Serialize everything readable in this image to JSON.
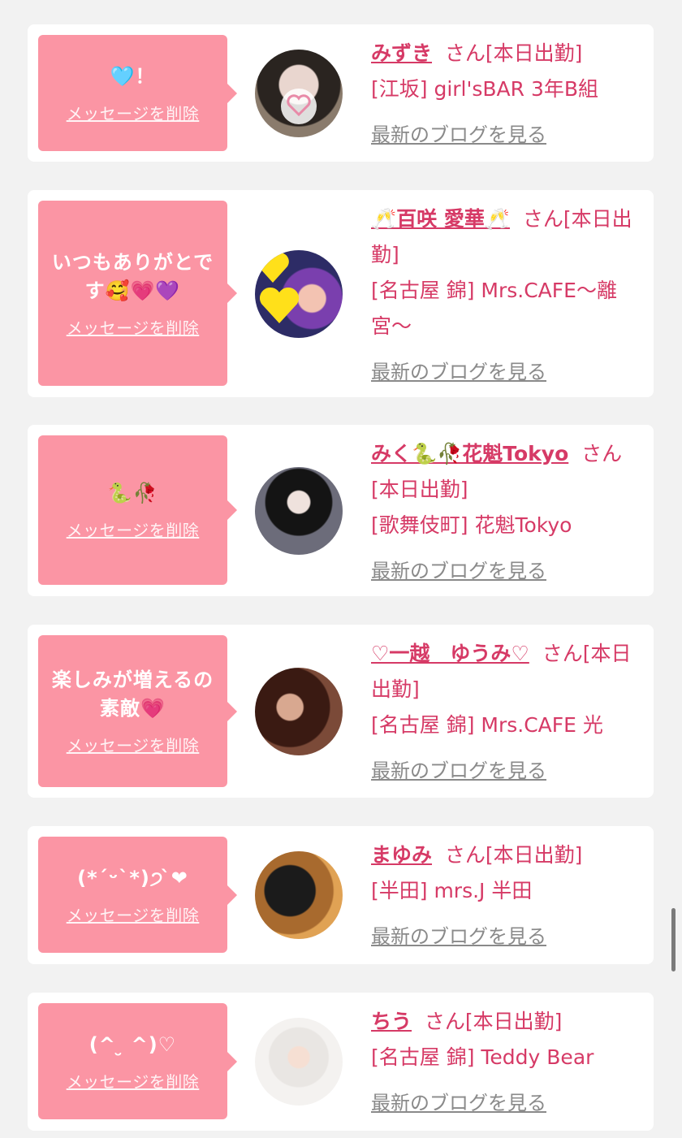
{
  "colors": {
    "bubble": "#fb95a4",
    "accent": "#d63a66",
    "link_gray": "#8a8a8a",
    "background": "#f2f2f2"
  },
  "cards": [
    {
      "message": "🩵！",
      "delete_label": "メッセージを削除",
      "name": "みずき",
      "san": "さん[本日出勤]",
      "shop": "[江坂] girl'sBAR 3年B組",
      "blog_label": "最新のブログを見る",
      "avatar_icon": "avatar-photo"
    },
    {
      "message": "いつもありがとです🥰💗💜",
      "delete_label": "メッセージを削除",
      "name": "🥂百咲 愛華🥂",
      "san": "さん[本日出勤]",
      "shop": "[名古屋 錦] Mrs.CAFE〜離宮〜",
      "blog_label": "最新のブログを見る",
      "avatar_icon": "avatar-photo"
    },
    {
      "message": "🐍🥀",
      "delete_label": "メッセージを削除",
      "name": "みく🐍🥀花魁Tokyo",
      "san": "さん[本日出勤]",
      "shop": "[歌舞伎町] 花魁Tokyo",
      "blog_label": "最新のブログを見る",
      "avatar_icon": "avatar-photo"
    },
    {
      "message": "楽しみが増えるの素敵💗",
      "delete_label": "メッセージを削除",
      "name": "♡一越　ゆうみ♡",
      "san": "さん[本日出勤]",
      "shop": "[名古屋 錦] Mrs.CAFE 光",
      "blog_label": "最新のブログを見る",
      "avatar_icon": "avatar-photo"
    },
    {
      "message": "(*ˊᵕˋ*)੭ ̀❤",
      "delete_label": "メッセージを削除",
      "name": "まゆみ",
      "san": "さん[本日出勤]",
      "shop": "[半田] mrs.J 半田",
      "blog_label": "最新のブログを見る",
      "avatar_icon": "avatar-photo"
    },
    {
      "message": "(^ ̮ ^)♡",
      "delete_label": "メッセージを削除",
      "name": "ちう",
      "san": "さん[本日出勤]",
      "shop": "[名古屋 錦] Teddy Bear",
      "blog_label": "最新のブログを見る",
      "avatar_icon": "avatar-photo"
    }
  ]
}
